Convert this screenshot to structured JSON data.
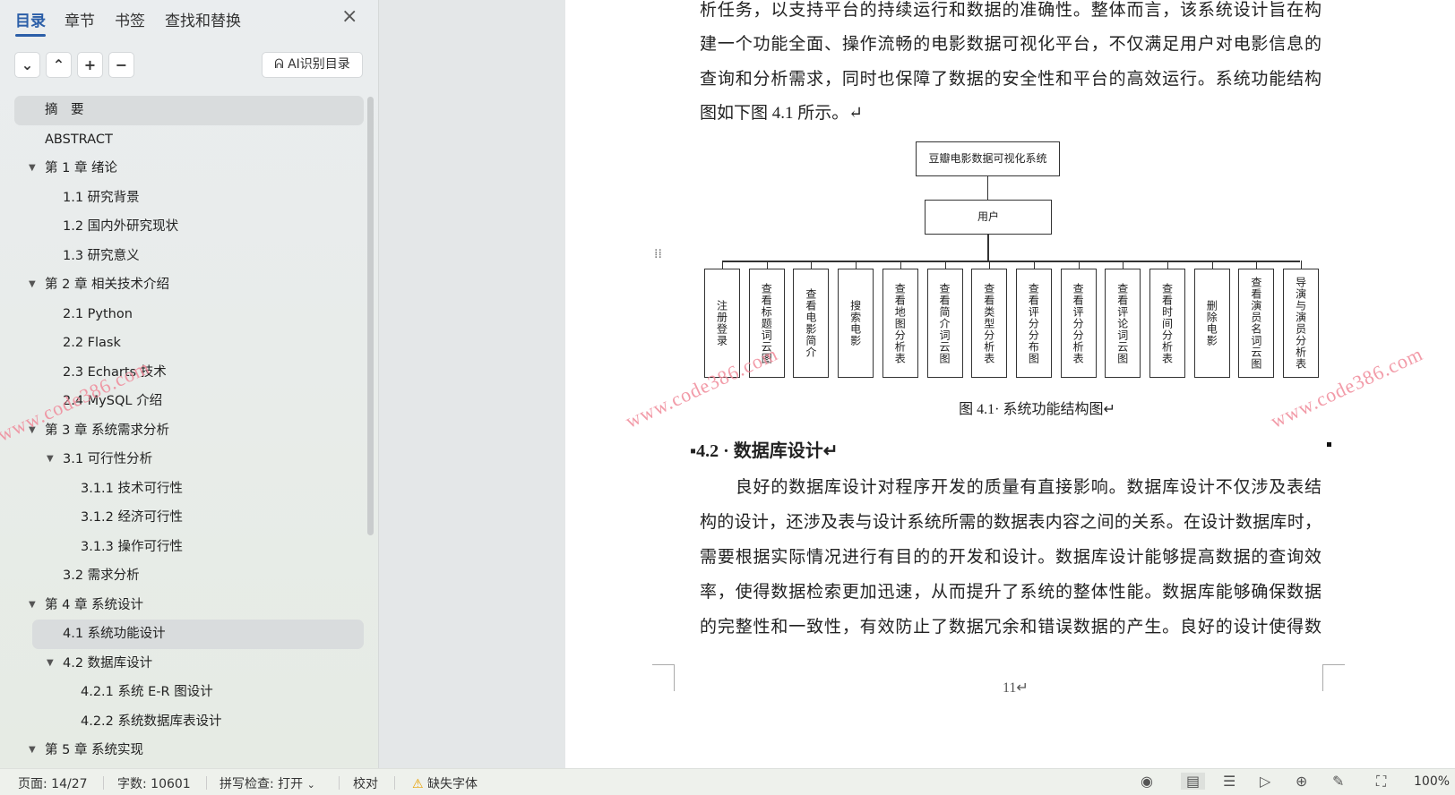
{
  "sidebar": {
    "tabs": [
      "目录",
      "章节",
      "书签",
      "查找和替换"
    ],
    "close": "×",
    "ai_button": "AI识别目录",
    "toc": [
      {
        "label": "摘　要",
        "level": 0,
        "selected": true
      },
      {
        "label": "ABSTRACT",
        "level": 0
      },
      {
        "label": "第 1 章  绪论",
        "level": 0,
        "arrow": true
      },
      {
        "label": "1.1  研究背景",
        "level": 1
      },
      {
        "label": "1.2  国内外研究现状",
        "level": 1
      },
      {
        "label": "1.3  研究意义",
        "level": 1
      },
      {
        "label": "第 2 章  相关技术介绍",
        "level": 0,
        "arrow": true
      },
      {
        "label": "2.1 Python",
        "level": 1
      },
      {
        "label": "2.2 Flask",
        "level": 1
      },
      {
        "label": "2.3 Echarts 技术",
        "level": 1
      },
      {
        "label": "2.4 MySQL 介绍",
        "level": 1
      },
      {
        "label": "第 3 章  系统需求分析",
        "level": 0,
        "arrow": true
      },
      {
        "label": "3.1  可行性分析",
        "level": 1,
        "arrow": true
      },
      {
        "label": "3.1.1 技术可行性",
        "level": 2
      },
      {
        "label": "3.1.2 经济可行性",
        "level": 2
      },
      {
        "label": "3.1.3 操作可行性",
        "level": 2
      },
      {
        "label": "3.2  需求分析",
        "level": 1
      },
      {
        "label": "第 4 章  系统设计",
        "level": 0,
        "arrow": true
      },
      {
        "label": "4.1  系统功能设计",
        "level": 1,
        "selected": true
      },
      {
        "label": "4.2  数据库设计",
        "level": 1,
        "arrow": true
      },
      {
        "label": "4.2.1 系统 E-R 图设计",
        "level": 2
      },
      {
        "label": "4.2.2 系统数据库表设计",
        "level": 2
      },
      {
        "label": "第 5 章  系统实现",
        "level": 0,
        "arrow": true
      }
    ]
  },
  "document": {
    "para1": [
      "析任务，以支持平台的持续运行和数据的准确性。整体而言，该系统设计旨在构",
      "建一个功能全面、操作流畅的电影数据可视化平台，不仅满足用户对电影信息的",
      "查询和分析需求，同时也保障了数据的安全性和平台的高效运行。系统功能结构",
      "图如下图 4.1 所示。↵"
    ],
    "diagram": {
      "root": "豆瓣电影数据可视化系统",
      "user": "用户",
      "children": [
        "注册登录",
        "查看标题词云图",
        "查看电影简介",
        "搜索电影",
        "查看地图分析表",
        "查看简介词云图",
        "查看类型分析表",
        "查看评分分布图",
        "查看评分分析表",
        "查看评论词云图",
        "查看时间分析表",
        "删除电影",
        "查看演员名词云图",
        "导演与演员分析表"
      ]
    },
    "caption": "图 4.1· 系统功能结构图↵",
    "heading": "4.2 · 数据库设计↵",
    "para2": [
      "　　良好的数据库设计对程序开发的质量有直接影响。数据库设计不仅涉及表结",
      "构的设计，还涉及表与设计系统所需的数据表内容之间的关系。在设计数据库时，",
      "需要根据实际情况进行有目的的开发和设计。数据库设计能够提高数据的查询效",
      "率，使得数据检索更加迅速，从而提升了系统的整体性能。数据库能够确保数据",
      "的完整性和一致性，有效防止了数据冗余和错误数据的产生。良好的设计使得数"
    ],
    "page_number": "11↵",
    "watermark": "www.code386.com"
  },
  "status": {
    "page": "页面: 14/27",
    "words": "字数: 10601",
    "spell": "拼写检查: 打开",
    "spell_arrow": "⌄",
    "proof": "校对",
    "missing_font": "缺失字体",
    "zoom": "100%"
  }
}
